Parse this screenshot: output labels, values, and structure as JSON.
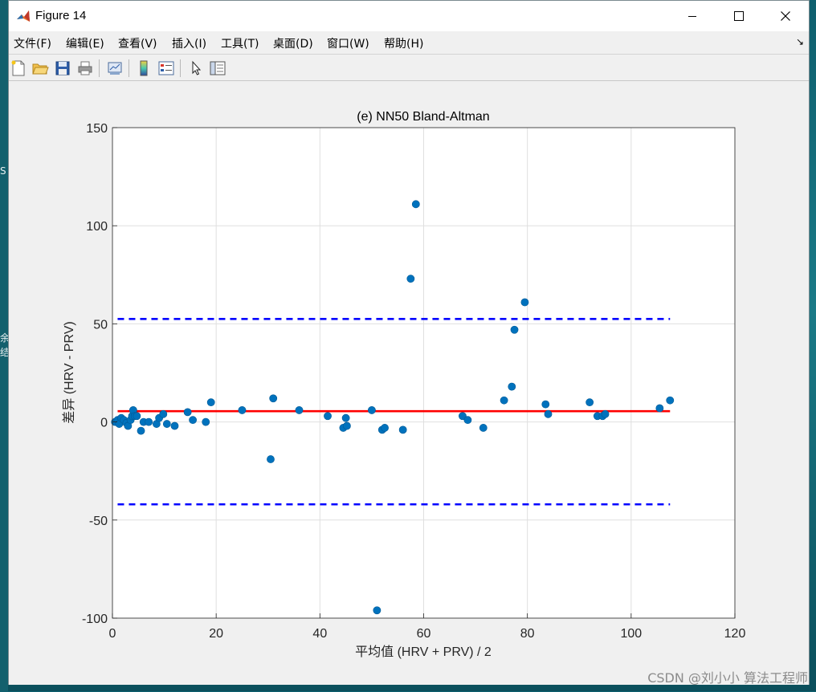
{
  "window": {
    "title": "Figure 14",
    "menu": [
      "文件(F)",
      "编辑(E)",
      "查看(V)",
      "插入(I)",
      "工具(T)",
      "桌面(D)",
      "窗口(W)",
      "帮助(H)"
    ],
    "menu_arrow": "↘",
    "toolbar_icons": [
      "new-figure-icon",
      "open-file-icon",
      "save-icon",
      "print-icon",
      "link-plot-icon",
      "colorbar-icon",
      "legend-icon",
      "pointer-icon",
      "property-inspector-icon"
    ]
  },
  "desktop": {
    "edge_chars": [
      "S",
      "余",
      "结"
    ]
  },
  "watermark": "CSDN @刘小小 算法工程师",
  "chart_data": {
    "type": "scatter",
    "title": "(e) NN50 Bland-Altman",
    "xlabel": "平均值 (HRV + PRV) / 2",
    "ylabel": "差异 (HRV - PRV)",
    "xlim": [
      0,
      120
    ],
    "ylim": [
      -100,
      150
    ],
    "xticks": [
      "0",
      "20",
      "40",
      "60",
      "80",
      "100",
      "120"
    ],
    "yticks": [
      "-100",
      "-50",
      "0",
      "50",
      "100",
      "150"
    ],
    "grid": true,
    "marker_color": "#0072BD",
    "points": [
      [
        0.5,
        0
      ],
      [
        1,
        1
      ],
      [
        1.3,
        -1
      ],
      [
        1.7,
        2
      ],
      [
        2.2,
        1
      ],
      [
        2.7,
        -0.5
      ],
      [
        3,
        -2
      ],
      [
        3.5,
        1
      ],
      [
        3.8,
        3
      ],
      [
        4,
        6
      ],
      [
        4.3,
        3
      ],
      [
        4.7,
        3
      ],
      [
        5.5,
        -4.5
      ],
      [
        6,
        0
      ],
      [
        7,
        0
      ],
      [
        8.5,
        -1
      ],
      [
        9,
        2
      ],
      [
        9.8,
        4
      ],
      [
        10.5,
        -1
      ],
      [
        12,
        -2
      ],
      [
        14.5,
        5
      ],
      [
        15.5,
        1
      ],
      [
        18,
        0
      ],
      [
        19,
        10
      ],
      [
        25,
        6
      ],
      [
        30.5,
        -19
      ],
      [
        31,
        12
      ],
      [
        36,
        6
      ],
      [
        41.5,
        3
      ],
      [
        44.5,
        -3
      ],
      [
        45,
        2
      ],
      [
        45.2,
        -2
      ],
      [
        50,
        6
      ],
      [
        51,
        -96
      ],
      [
        52,
        -4
      ],
      [
        52.5,
        -3
      ],
      [
        56,
        -4
      ],
      [
        57.5,
        73
      ],
      [
        58.5,
        111
      ],
      [
        67.5,
        3
      ],
      [
        68.5,
        1
      ],
      [
        71.5,
        -3
      ],
      [
        75.5,
        11
      ],
      [
        77,
        18
      ],
      [
        77.5,
        47
      ],
      [
        79.5,
        61
      ],
      [
        83.5,
        9
      ],
      [
        84,
        4
      ],
      [
        92,
        10
      ],
      [
        93.5,
        3
      ],
      [
        94.5,
        3
      ],
      [
        95,
        4
      ],
      [
        105.5,
        7
      ],
      [
        107.5,
        11
      ]
    ],
    "mean_line": {
      "value": 5.5,
      "x_range": [
        1,
        107.5
      ],
      "color": "#FF0000",
      "style": "solid"
    },
    "loa_lines": [
      {
        "value": 52.5,
        "x_range": [
          1,
          107.5
        ],
        "color": "#0000FF",
        "style": "dashed"
      },
      {
        "value": -42,
        "x_range": [
          1,
          107.5
        ],
        "color": "#0000FF",
        "style": "dashed"
      }
    ]
  }
}
